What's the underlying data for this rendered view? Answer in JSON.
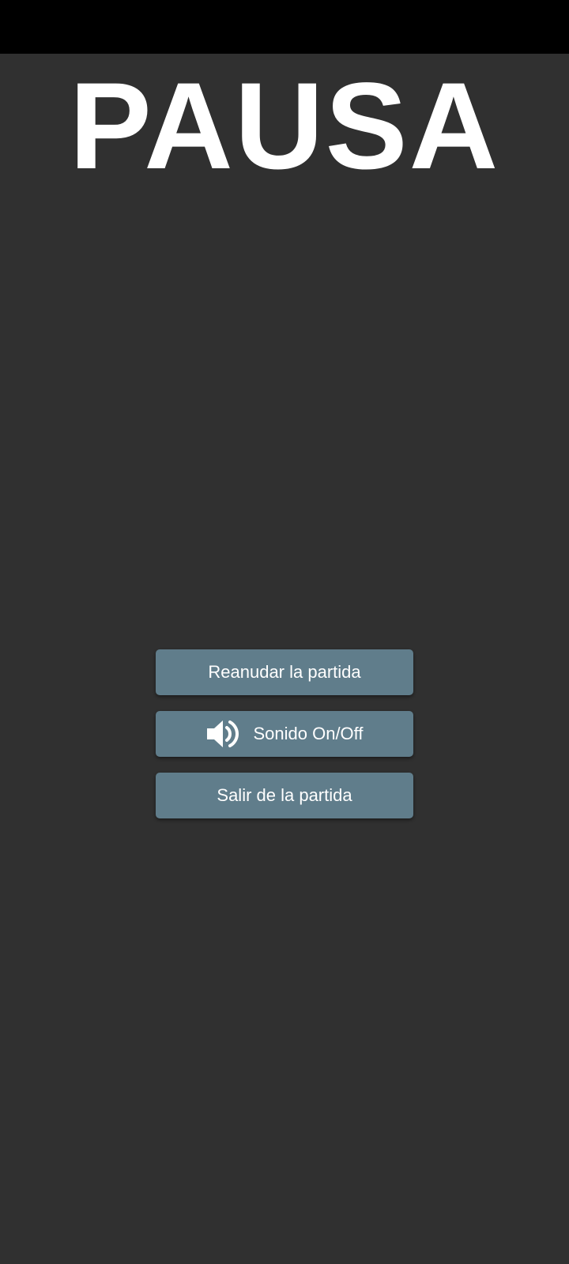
{
  "pause_menu": {
    "title": "PAUSA",
    "buttons": {
      "resume_label": "Reanudar la partida",
      "sound_label": "Sonido On/Off",
      "sound_icon": "volume-icon",
      "exit_label": "Salir de la partida"
    }
  },
  "colors": {
    "background": "#303030",
    "status_bar": "#000000",
    "button": "#607d8b",
    "text": "#ffffff"
  }
}
